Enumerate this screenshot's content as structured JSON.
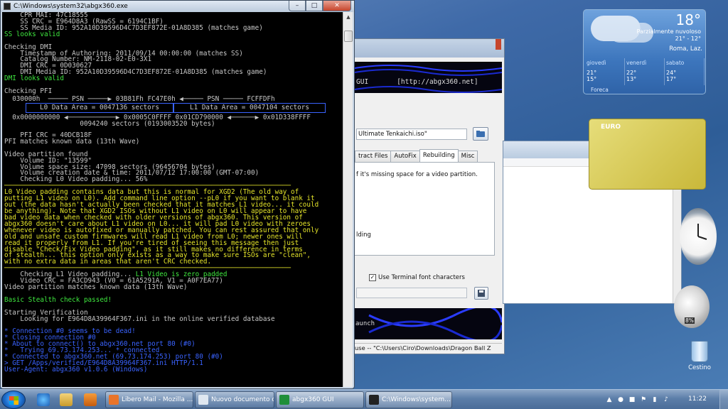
{
  "console": {
    "title": "C:\\Windows\\system32\\abgx360.exe",
    "lines_top": [
      {
        "t": "    CPR_MAI: 47C18555",
        "c": ""
      },
      {
        "t": "    SS CRC = E964D8A3 (RawSS = 6194C1BF)",
        "c": ""
      },
      {
        "t": "    SS Media ID: 952A10D39596D4C7D3EF872E-01A8D385 (matches game)",
        "c": ""
      },
      {
        "t": "SS looks valid",
        "c": "g"
      },
      {
        "t": "",
        "c": ""
      },
      {
        "t": "Checking DMI",
        "c": ""
      },
      {
        "t": "    Timestamp of Authoring: 2011/09/14 00:00:00 (matches SS)",
        "c": ""
      },
      {
        "t": "    Catalog Number: NM-2118-02-E0-3X1",
        "c": ""
      },
      {
        "t": "    DMI CRC = 0D030627",
        "c": ""
      },
      {
        "t": "    DMI Media ID: 952A10D39596D4C7D3EF872E-01A8D385 (matches game)",
        "c": ""
      },
      {
        "t": "DMI looks valid",
        "c": "g"
      },
      {
        "t": "",
        "c": ""
      },
      {
        "t": "Checking PFI",
        "c": ""
      }
    ],
    "pfi": {
      "row1": "  030000h  ───── PSN ─────▶ 03B81Fh FC47E0h ◀───── PSN ───── FCFFDFh",
      "l0": "L0 Data Area = 0047136 sectors",
      "l1": "L1 Data Area = 0047104 sectors",
      "row3": "  0x0000000000 ◀────────────▶ 0x0005C0FFFF 0x01CD790000 ◀──────▶ 0x01D338FFFF",
      "row4": "                   0094240 sectors (0193003520 bytes)"
    },
    "lines_mid": [
      {
        "t": "",
        "c": ""
      },
      {
        "t": "    PFI CRC = 40DCB18F",
        "c": ""
      },
      {
        "t": "PFI matches known data (13th Wave)",
        "c": ""
      },
      {
        "t": "",
        "c": ""
      },
      {
        "t": "Video partition found",
        "c": ""
      },
      {
        "t": "    Volume ID: \"13599\"",
        "c": ""
      },
      {
        "t": "    Volume space size: 47098 sectors (96456704 bytes)",
        "c": ""
      },
      {
        "t": "    Volume creation date & time: 2011/07/12 17:00:00 (GMT-07:00)",
        "c": ""
      },
      {
        "t": "    Checking L0 Video padding... 56%",
        "c": ""
      },
      {
        "t": "────────────────────────────────────────────────────────────────────────",
        "c": "sep"
      },
      {
        "t": "L0 Video padding contains data but this is normal for XGD2 (The old way of",
        "c": "y"
      },
      {
        "t": "putting L1 video on L0). Add command line option --pL0 if you want to blank it",
        "c": "y"
      },
      {
        "t": "out (the data hasn't actually been checked that it matches L1 video... it could",
        "c": "y"
      },
      {
        "t": "be anything). Note that XGD2 ISOs without L1 video on L0 will appear to have",
        "c": "y"
      },
      {
        "t": "bad video data when checked with older versions of abgx360. This version of",
        "c": "y"
      },
      {
        "t": "abgx360 doesn't care about L1 video on L0... it will pad L0 video with zeroes",
        "c": "y"
      },
      {
        "t": "whenever video is autofixed or manually patched. You can rest assured that only",
        "c": "y"
      },
      {
        "t": "old and unsafe custom firmwares will read L1 video from L0; newer ones will",
        "c": "y"
      },
      {
        "t": "read it properly from L1. If you're tired of seeing this message then just",
        "c": "y"
      },
      {
        "t": "disable \"Check/Fix Video padding\", as it still makes no difference in terms",
        "c": "y"
      },
      {
        "t": "of stealth... this option only exists as a way to make sure ISOs are \"clean\",",
        "c": "y"
      },
      {
        "t": "with no extra data in areas that aren't CRC checked.",
        "c": "y"
      },
      {
        "t": "────────────────────────────────────────────────────────────────────────",
        "c": "sep"
      }
    ],
    "l1_check": "    Checking L1 Video padding... ",
    "l1_result": "L1 Video is zero padded",
    "lines_bottom": [
      {
        "t": "    Video CRC = FA3CD943 (V0 = 61A5291A, V1 = A0F7EA77)",
        "c": ""
      },
      {
        "t": "Video partition matches known data (13th Wave)",
        "c": ""
      },
      {
        "t": "",
        "c": ""
      },
      {
        "t": "Basic Stealth check passed!",
        "c": "g"
      },
      {
        "t": "",
        "c": ""
      },
      {
        "t": "Starting Verification",
        "c": ""
      },
      {
        "t": "    Looking for E964D8A39964F367.ini in the online verified database",
        "c": ""
      },
      {
        "t": "",
        "c": ""
      },
      {
        "t": "* Connection #0 seems to be dead!",
        "c": "b"
      },
      {
        "t": "* Closing connection #0",
        "c": "b"
      },
      {
        "t": "* About to connect() to abgx360.net port 80 (#0)",
        "c": "b"
      },
      {
        "t": "*   Trying 69.73.174.253... * connected",
        "c": "b"
      },
      {
        "t": "* Connected to abgx360.net (69.73.174.253) port 80 (#0)",
        "c": "b"
      },
      {
        "t": "> GET /Apps/verified/E964D8A39964F367.ini HTTP/1.1",
        "c": "b"
      },
      {
        "t": "User-Agent: abgx360 v1.0.6 (Windows)",
        "c": "b"
      }
    ]
  },
  "gui": {
    "banner": "GUI       [http://abgx360.net]",
    "iso_value": "Ultimate Tenkaichi.iso\"",
    "tabs": [
      {
        "label": "tract Files",
        "active": false
      },
      {
        "label": "AutoFix",
        "active": false
      },
      {
        "label": "Rebuilding",
        "active": true
      },
      {
        "label": "Misc",
        "active": false
      }
    ],
    "panel_text1": "f it's missing space for a video partition.",
    "panel_text2": "lding",
    "terminal_font_label": "Use Terminal font characters",
    "terminal_font_checked": true,
    "log_text": "aunch",
    "status": "use -- \"C:\\Users\\Ciro\\Downloads\\Dragon Ball Z"
  },
  "weather": {
    "temp": "18°",
    "condition": "Parzialmente nuvoloso",
    "range": "21° - 12°",
    "location": "Roma, Laz.",
    "days": [
      {
        "day": "giovedì",
        "hi": "21°",
        "lo": "15°"
      },
      {
        "day": "venerdì",
        "hi": "22°",
        "lo": "13°"
      },
      {
        "day": "sabato",
        "hi": "24°",
        "lo": "17°"
      }
    ],
    "provider": "Foreca"
  },
  "currency": {
    "label": "EURO"
  },
  "cpu_meter": {
    "percent": "8%"
  },
  "recycle_bin": {
    "label": "Cestino"
  },
  "taskbar": {
    "tasks": [
      {
        "label": "Libero Mail - Mozilla ...",
        "color": "#e8742a"
      },
      {
        "label": "Nuovo documento d...",
        "color": "#dfe7f0"
      },
      {
        "label": "abgx360 GUI",
        "color": "#1f8f3a"
      },
      {
        "label": "C:\\Windows\\system...",
        "color": "#222222"
      }
    ],
    "clock": "11:22"
  }
}
